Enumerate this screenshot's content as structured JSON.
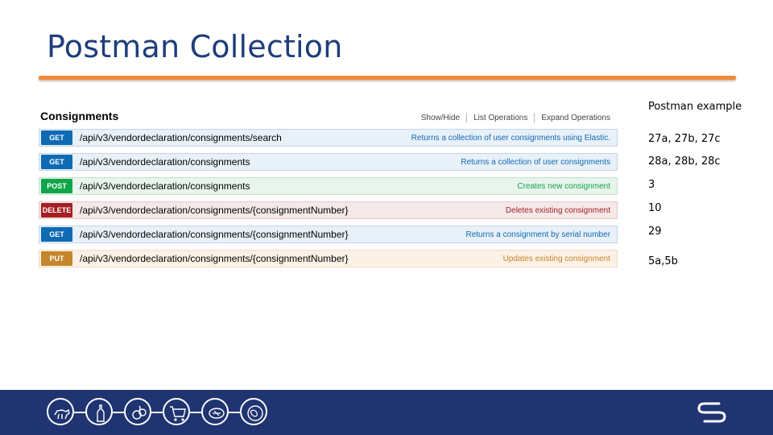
{
  "slide": {
    "title": "Postman Collection"
  },
  "api": {
    "resource": "Consignments",
    "header_links": [
      "Show/Hide",
      "List Operations",
      "Expand Operations"
    ],
    "operations": [
      {
        "method": "GET",
        "path": "/api/v3/vendordeclaration/consignments/search",
        "summary": "Returns a collection of user consignments using Elastic."
      },
      {
        "method": "GET",
        "path": "/api/v3/vendordeclaration/consignments",
        "summary": "Returns a collection of user consignments"
      },
      {
        "method": "POST",
        "path": "/api/v3/vendordeclaration/consignments",
        "summary": "Creates new consignment"
      },
      {
        "method": "DELETE",
        "path": "/api/v3/vendordeclaration/consignments/{consignmentNumber}",
        "summary": "Deletes existing consignment"
      },
      {
        "method": "GET",
        "path": "/api/v3/vendordeclaration/consignments/{consignmentNumber}",
        "summary": "Returns a consignment by serial number"
      },
      {
        "method": "PUT",
        "path": "/api/v3/vendordeclaration/consignments/{consignmentNumber}",
        "summary": "Updates existing consignment"
      }
    ]
  },
  "postman": {
    "header": "Postman example",
    "examples": [
      "27a, 27b, 27c",
      "28a, 28b, 28c",
      "3",
      "10",
      "29",
      "5a,5b"
    ]
  },
  "footer": {
    "icons": [
      "livestock-icon",
      "wine-bottle-icon",
      "produce-icon",
      "shopping-cart-icon",
      "steak-icon",
      "globe-icon"
    ],
    "logo": "company-logo-icon"
  },
  "colors": {
    "title": "#1f3d7a",
    "rule": "#f08a3a",
    "footer": "#1f3470",
    "get": "#0f6ab4",
    "post": "#10a54a",
    "delete": "#a41e22",
    "put": "#c5862b"
  }
}
